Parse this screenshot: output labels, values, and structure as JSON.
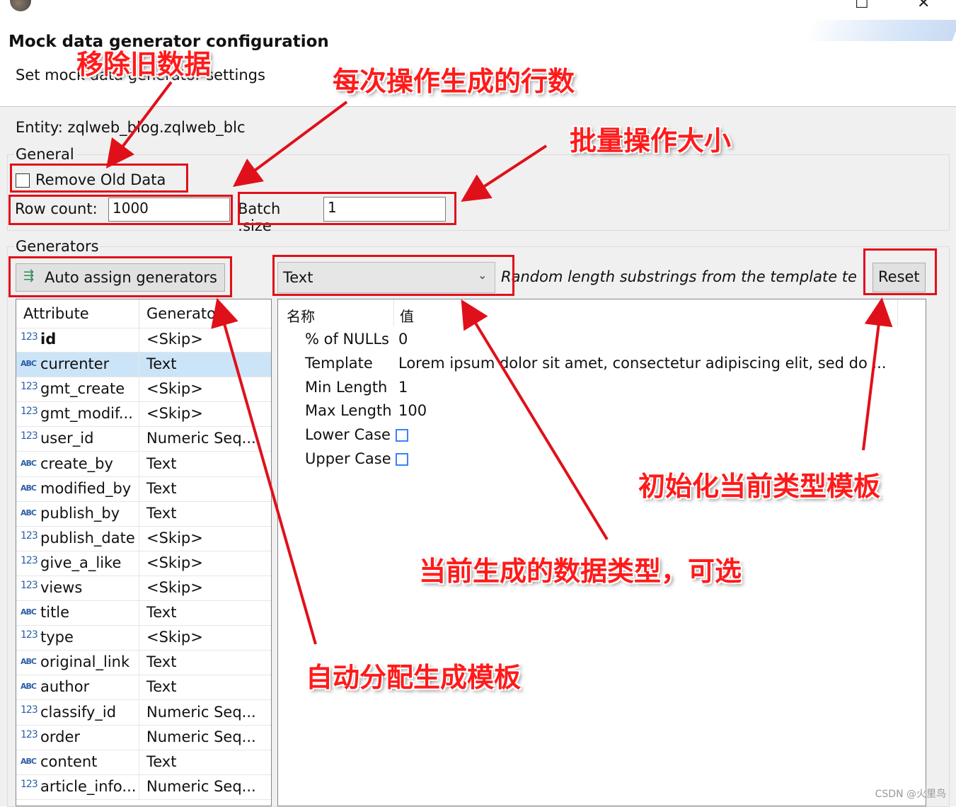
{
  "window": {
    "title": "Mock data generator configuration",
    "subtitle": "Set mock data generator settings",
    "minimize_glyph": "☐",
    "close_glyph": "✕"
  },
  "entity": {
    "label": "Entity:",
    "value": "zqlweb_blog.zqlweb_blc"
  },
  "general": {
    "title": "General",
    "remove_old_data_label": "Remove Old Data",
    "remove_old_data_checked": false,
    "row_count_label": "Row count:",
    "row_count_value": "1000",
    "batch_size_label": "Batch size:",
    "batch_size_value": "1"
  },
  "generators": {
    "title": "Generators",
    "auto_assign_label": "Auto assign generators",
    "auto_assign_icon": "auto-assign-icon",
    "selected_generator": "Text",
    "description": "Random length substrings from the template te",
    "reset_label": "Reset",
    "attribute_header": "Attribute",
    "generator_header": "Generato",
    "attributes": [
      {
        "type": "123",
        "name": "id",
        "generator": "<Skip>",
        "bold": true
      },
      {
        "type": "ABC",
        "name": "currenter",
        "generator": "Text",
        "selected": true
      },
      {
        "type": "123",
        "name": "gmt_create",
        "generator": "<Skip>"
      },
      {
        "type": "123",
        "name": "gmt_modif...",
        "generator": "<Skip>"
      },
      {
        "type": "123",
        "name": "user_id",
        "generator": "Numeric Seq..."
      },
      {
        "type": "ABC",
        "name": "create_by",
        "generator": "Text"
      },
      {
        "type": "ABC",
        "name": "modified_by",
        "generator": "Text"
      },
      {
        "type": "ABC",
        "name": "publish_by",
        "generator": "Text"
      },
      {
        "type": "123",
        "name": "publish_date",
        "generator": "<Skip>"
      },
      {
        "type": "123",
        "name": "give_a_like",
        "generator": "<Skip>"
      },
      {
        "type": "123",
        "name": "views",
        "generator": "<Skip>"
      },
      {
        "type": "ABC",
        "name": "title",
        "generator": "Text"
      },
      {
        "type": "123",
        "name": "type",
        "generator": "<Skip>"
      },
      {
        "type": "ABC",
        "name": "original_link",
        "generator": "Text"
      },
      {
        "type": "ABC",
        "name": "author",
        "generator": "Text"
      },
      {
        "type": "123",
        "name": "classify_id",
        "generator": "Numeric Seq..."
      },
      {
        "type": "123",
        "name": "order",
        "generator": "Numeric Seq..."
      },
      {
        "type": "ABC",
        "name": "content",
        "generator": "Text"
      },
      {
        "type": "123",
        "name": "article_info...",
        "generator": "Numeric Seq..."
      }
    ],
    "properties_header_name": "名称",
    "properties_header_value": "值",
    "properties": [
      {
        "name": "% of NULLs",
        "value": "0"
      },
      {
        "name": "Template",
        "value": "Lorem ipsum dolor sit amet, consectetur adipiscing elit, sed do ..."
      },
      {
        "name": "Min Length",
        "value": "1"
      },
      {
        "name": "Max Length",
        "value": "100"
      },
      {
        "name": "Lower Case",
        "value": "",
        "checkbox": true
      },
      {
        "name": "Upper Case",
        "value": "",
        "checkbox": true
      }
    ]
  },
  "annotations": {
    "remove_old": "移除旧数据",
    "rows_per_op": "每次操作生成的行数",
    "batch_size": "批量操作大小",
    "reset_template": "初始化当前类型模板",
    "data_type": "当前生成的数据类型，可选",
    "auto_assign": "自动分配生成模板",
    "color": "#e0101a"
  },
  "watermark": "CSDN @火里鸟"
}
